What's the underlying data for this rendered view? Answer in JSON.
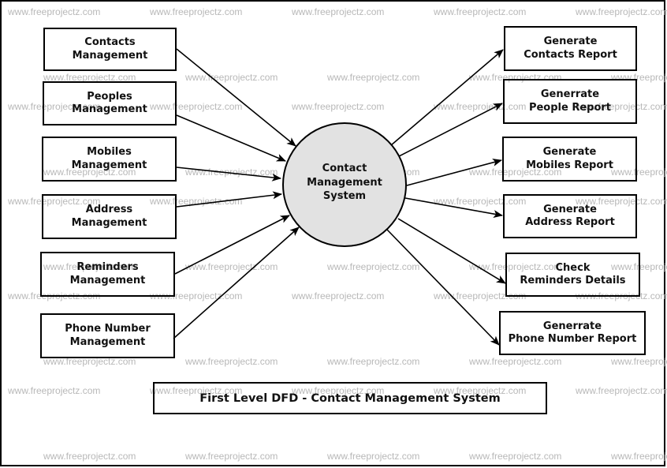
{
  "diagram": {
    "title": "First Level DFD - Contact Management System",
    "center_process": {
      "lines": [
        "Contact",
        "Management",
        "System"
      ],
      "fill": "#e2e2e2"
    },
    "watermark_text": "www.freeprojectz.com",
    "inputs": [
      {
        "id": "contacts-management",
        "lines": [
          "Contacts",
          "Management"
        ]
      },
      {
        "id": "peoples-management",
        "lines": [
          "Peoples",
          "Management"
        ]
      },
      {
        "id": "mobiles-management",
        "lines": [
          "Mobiles",
          "Management"
        ]
      },
      {
        "id": "address-management",
        "lines": [
          "Address",
          "Management"
        ]
      },
      {
        "id": "reminders-management",
        "lines": [
          "Reminders",
          "Management"
        ]
      },
      {
        "id": "phone-number-management",
        "lines": [
          "Phone Number",
          "Management"
        ]
      }
    ],
    "outputs": [
      {
        "id": "generate-contacts-report",
        "lines": [
          "Generate",
          "Contacts Report"
        ]
      },
      {
        "id": "generate-people-report",
        "lines": [
          "Generrate",
          "People Report"
        ]
      },
      {
        "id": "generate-mobiles-report",
        "lines": [
          "Generate",
          "Mobiles Report"
        ]
      },
      {
        "id": "generate-address-report",
        "lines": [
          "Generate",
          "Address Report"
        ]
      },
      {
        "id": "check-reminders-details",
        "lines": [
          "Check",
          "Reminders Details"
        ]
      },
      {
        "id": "generate-phone-number-report",
        "lines": [
          "Generrate",
          "Phone Number Report"
        ]
      }
    ],
    "flows": [
      {
        "from": "contacts-management",
        "to": "center"
      },
      {
        "from": "peoples-management",
        "to": "center"
      },
      {
        "from": "mobiles-management",
        "to": "center"
      },
      {
        "from": "address-management",
        "to": "center"
      },
      {
        "from": "reminders-management",
        "to": "center"
      },
      {
        "from": "phone-number-management",
        "to": "center"
      },
      {
        "from": "center",
        "to": "generate-contacts-report"
      },
      {
        "from": "center",
        "to": "generate-people-report"
      },
      {
        "from": "center",
        "to": "generate-mobiles-report"
      },
      {
        "from": "center",
        "to": "generate-address-report"
      },
      {
        "from": "center",
        "to": "check-reminders-details"
      },
      {
        "from": "center",
        "to": "generate-phone-number-report"
      }
    ]
  }
}
